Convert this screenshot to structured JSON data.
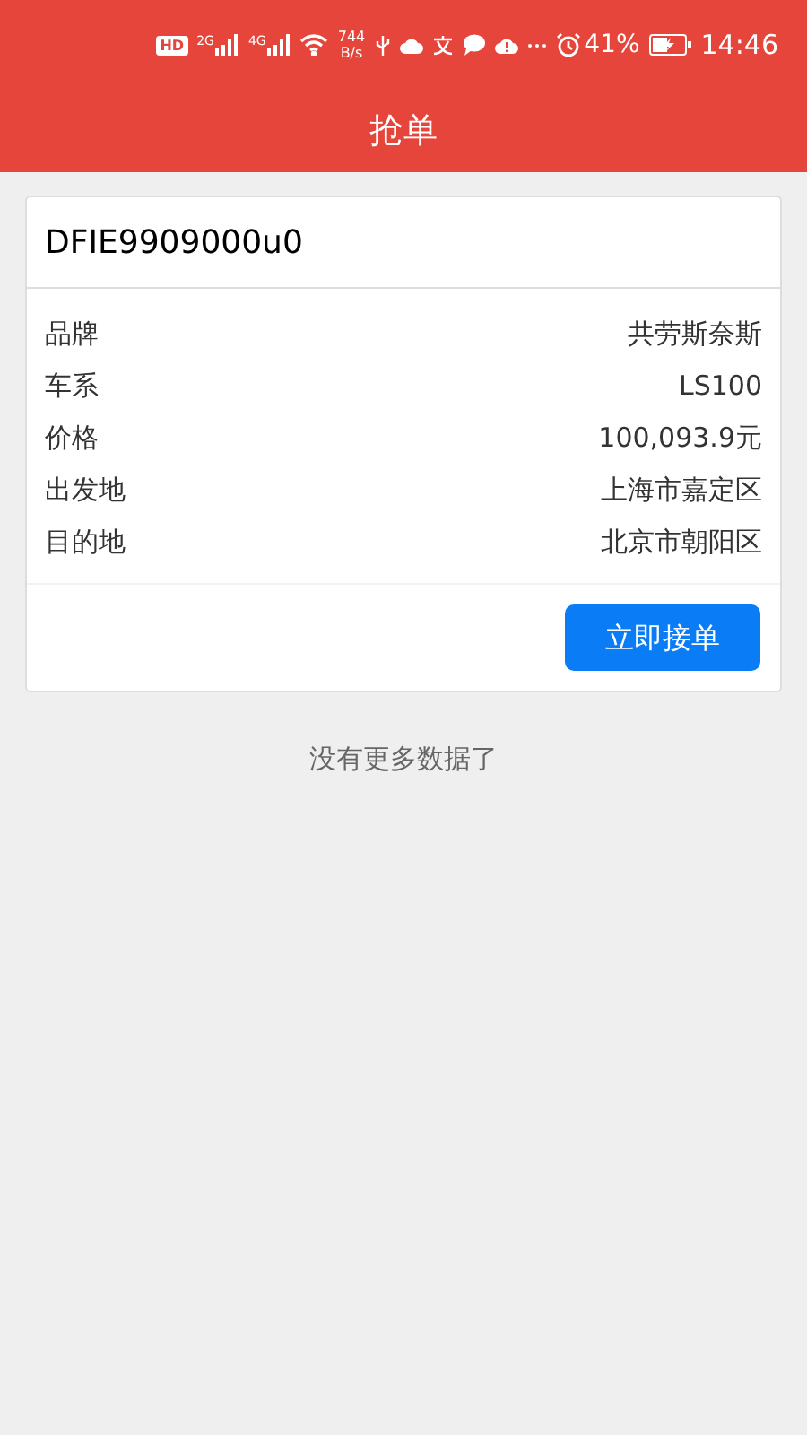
{
  "status_bar": {
    "hd": "HD",
    "network_1": "2G",
    "network_2": "4G",
    "speed": "744",
    "speed_unit": "B/s",
    "battery": "41%",
    "time": "14:46"
  },
  "header": {
    "title": "抢单"
  },
  "orders": [
    {
      "code": "DFIE9909000u0",
      "fields": [
        {
          "label": "品牌",
          "value": "共劳斯奈斯"
        },
        {
          "label": "车系",
          "value": "LS100"
        },
        {
          "label": "价格",
          "value": "100,093.9元"
        },
        {
          "label": "出发地",
          "value": "上海市嘉定区"
        },
        {
          "label": "目的地",
          "value": "北京市朝阳区"
        }
      ],
      "action": "立即接单"
    }
  ],
  "footer": "没有更多数据了"
}
